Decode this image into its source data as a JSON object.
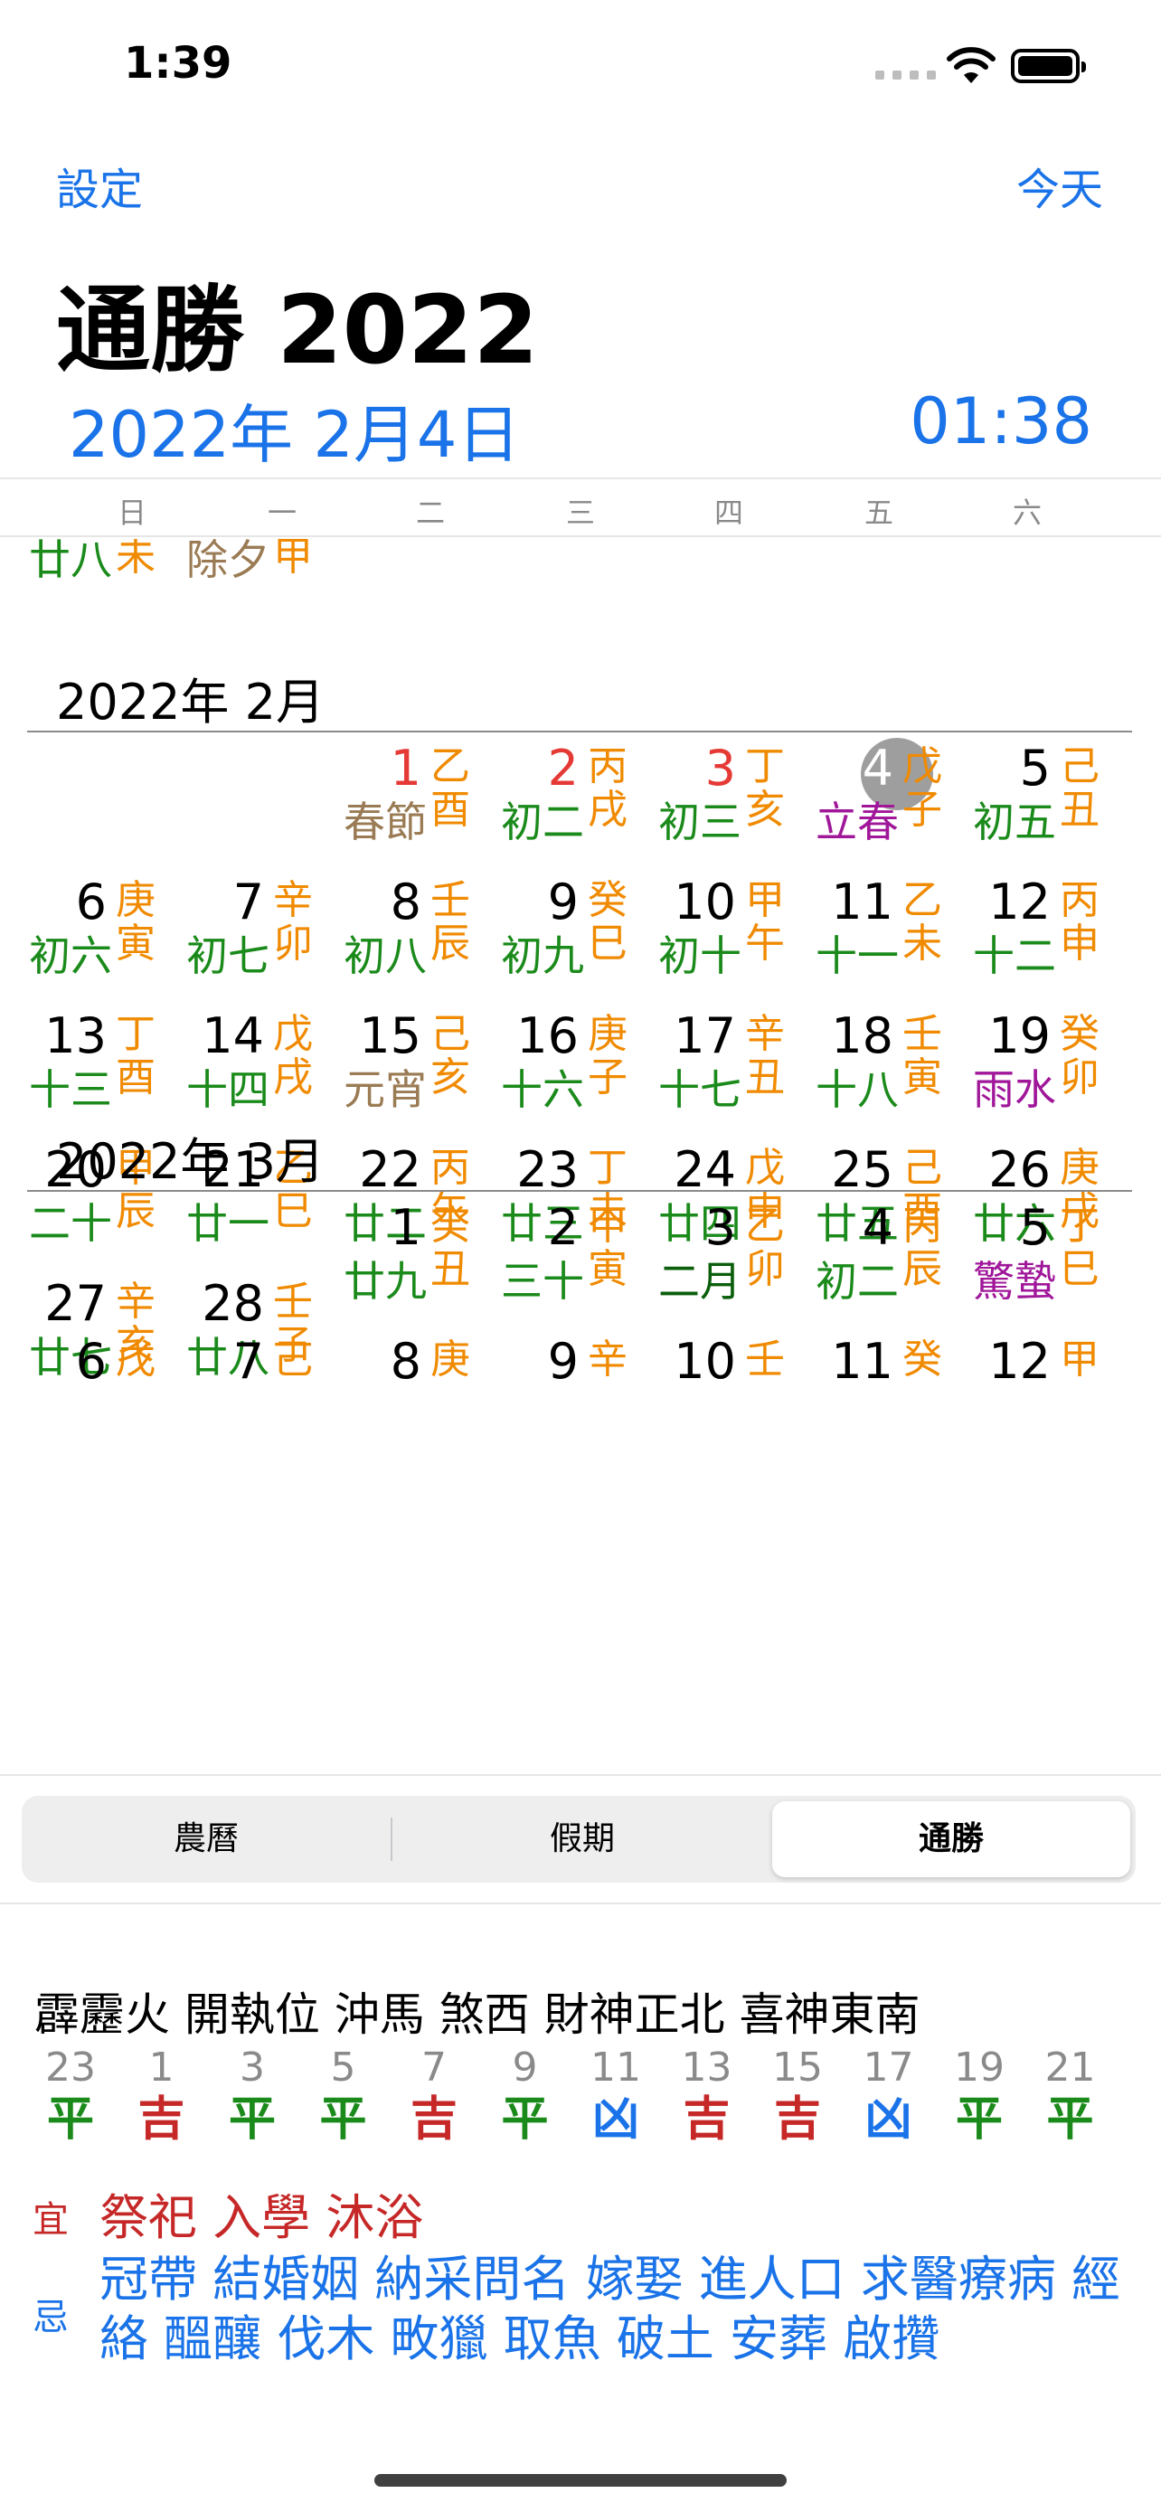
{
  "status": {
    "time": "1:39"
  },
  "nav": {
    "left": "設定",
    "right": "今天"
  },
  "title": "通勝 2022",
  "date": {
    "left": "2022年 2月4日",
    "right": "01:38"
  },
  "weekdays": [
    "日",
    "一",
    "二",
    "三",
    "四",
    "五",
    "六"
  ],
  "partial_top": [
    {
      "text": "廿八",
      "gz": "未",
      "color": "#1a8a1a"
    },
    {
      "text": "除夕",
      "gz": "甲",
      "color": "#9a7b54"
    }
  ],
  "months": [
    {
      "header": "2022年 2月",
      "days": [
        {
          "d": "1",
          "l": "春節",
          "gz": "乙酉",
          "dc": "#e53935",
          "lc": "#9a7b54"
        },
        {
          "d": "2",
          "l": "初二",
          "gz": "丙戌",
          "dc": "#e53935",
          "lc": "#1a8a1a"
        },
        {
          "d": "3",
          "l": "初三",
          "gz": "丁亥",
          "dc": "#e53935",
          "lc": "#1a8a1a"
        },
        {
          "d": "4",
          "l": "立春",
          "gz": "戊子",
          "dc": "#ffffff",
          "lc": "#a0179a"
        },
        {
          "d": "5",
          "l": "初五",
          "gz": "己丑",
          "dc": "#000",
          "lc": "#1a8a1a"
        },
        {
          "d": "6",
          "l": "初六",
          "gz": "庚寅",
          "dc": "#000",
          "lc": "#1a8a1a"
        },
        {
          "d": "7",
          "l": "初七",
          "gz": "辛卯",
          "dc": "#000",
          "lc": "#1a8a1a"
        },
        {
          "d": "8",
          "l": "初八",
          "gz": "壬辰",
          "dc": "#000",
          "lc": "#1a8a1a"
        },
        {
          "d": "9",
          "l": "初九",
          "gz": "癸巳",
          "dc": "#000",
          "lc": "#1a8a1a"
        },
        {
          "d": "10",
          "l": "初十",
          "gz": "甲午",
          "dc": "#000",
          "lc": "#1a8a1a"
        },
        {
          "d": "11",
          "l": "十一",
          "gz": "乙未",
          "dc": "#000",
          "lc": "#1a8a1a"
        },
        {
          "d": "12",
          "l": "十二",
          "gz": "丙申",
          "dc": "#000",
          "lc": "#1a8a1a"
        },
        {
          "d": "13",
          "l": "十三",
          "gz": "丁酉",
          "dc": "#000",
          "lc": "#1a8a1a"
        },
        {
          "d": "14",
          "l": "十四",
          "gz": "戊戌",
          "dc": "#000",
          "lc": "#1a8a1a"
        },
        {
          "d": "15",
          "l": "元宵",
          "gz": "己亥",
          "dc": "#000",
          "lc": "#9a7b54"
        },
        {
          "d": "16",
          "l": "十六",
          "gz": "庚子",
          "dc": "#000",
          "lc": "#1a8a1a"
        },
        {
          "d": "17",
          "l": "十七",
          "gz": "辛丑",
          "dc": "#000",
          "lc": "#1a8a1a"
        },
        {
          "d": "18",
          "l": "十八",
          "gz": "壬寅",
          "dc": "#000",
          "lc": "#1a8a1a"
        },
        {
          "d": "19",
          "l": "雨水",
          "gz": "癸卯",
          "dc": "#000",
          "lc": "#a0179a"
        },
        {
          "d": "20",
          "l": "二十",
          "gz": "甲辰",
          "dc": "#000",
          "lc": "#1a8a1a"
        },
        {
          "d": "21",
          "l": "廿一",
          "gz": "乙巳",
          "dc": "#000",
          "lc": "#1a8a1a"
        },
        {
          "d": "22",
          "l": "廿二",
          "gz": "丙午",
          "dc": "#000",
          "lc": "#1a8a1a"
        },
        {
          "d": "23",
          "l": "廿三",
          "gz": "丁未",
          "dc": "#000",
          "lc": "#1a8a1a"
        },
        {
          "d": "24",
          "l": "廿四",
          "gz": "戊申",
          "dc": "#000",
          "lc": "#1a8a1a"
        },
        {
          "d": "25",
          "l": "廿五",
          "gz": "己酉",
          "dc": "#000",
          "lc": "#1a8a1a"
        },
        {
          "d": "26",
          "l": "廿六",
          "gz": "庚戌",
          "dc": "#000",
          "lc": "#1a8a1a"
        },
        {
          "d": "27",
          "l": "廿七",
          "gz": "辛亥",
          "dc": "#000",
          "lc": "#1a8a1a"
        },
        {
          "d": "28",
          "l": "廿八",
          "gz": "壬子",
          "dc": "#000",
          "lc": "#1a8a1a"
        }
      ]
    },
    {
      "header": "2022年 3月",
      "days": [
        {
          "d": "1",
          "l": "廿九",
          "gz": "癸丑",
          "dc": "#000",
          "lc": "#1a8a1a"
        },
        {
          "d": "2",
          "l": "三十",
          "gz": "甲寅",
          "dc": "#000",
          "lc": "#1a8a1a"
        },
        {
          "d": "3",
          "l": "二月",
          "gz": "乙卯",
          "dc": "#000",
          "lc": "#0b5e0b"
        },
        {
          "d": "4",
          "l": "初二",
          "gz": "丙辰",
          "dc": "#000",
          "lc": "#1a8a1a"
        },
        {
          "d": "5",
          "l": "驚蟄",
          "gz": "丁巳",
          "dc": "#000",
          "lc": "#a0179a"
        },
        {
          "d": "6",
          "l": "",
          "gz": "戊",
          "dc": "#000",
          "lc": "#1a8a1a"
        },
        {
          "d": "7",
          "l": "",
          "gz": "己",
          "dc": "#000",
          "lc": "#1a8a1a"
        },
        {
          "d": "8",
          "l": "",
          "gz": "庚",
          "dc": "#000",
          "lc": "#1a8a1a"
        },
        {
          "d": "9",
          "l": "",
          "gz": "辛",
          "dc": "#000",
          "lc": "#1a8a1a"
        },
        {
          "d": "10",
          "l": "",
          "gz": "壬",
          "dc": "#000",
          "lc": "#1a8a1a"
        },
        {
          "d": "11",
          "l": "",
          "gz": "癸",
          "dc": "#000",
          "lc": "#1a8a1a"
        },
        {
          "d": "12",
          "l": "",
          "gz": "甲",
          "dc": "#000",
          "lc": "#1a8a1a"
        }
      ]
    }
  ],
  "segments": [
    "農曆",
    "假期",
    "通勝"
  ],
  "selected_segment": "通勝",
  "info_line": "霹靂火 開執位 沖馬 煞西 財神正北 喜神東南",
  "hours": [
    {
      "h": "23",
      "v": "平",
      "c": "#1a8a1a"
    },
    {
      "h": "1",
      "v": "吉",
      "c": "#c62828"
    },
    {
      "h": "3",
      "v": "平",
      "c": "#1a8a1a"
    },
    {
      "h": "5",
      "v": "平",
      "c": "#1a8a1a"
    },
    {
      "h": "7",
      "v": "吉",
      "c": "#c62828"
    },
    {
      "h": "9",
      "v": "平",
      "c": "#1a8a1a"
    },
    {
      "h": "11",
      "v": "凶",
      "c": "#1a73e8"
    },
    {
      "h": "13",
      "v": "吉",
      "c": "#c62828"
    },
    {
      "h": "15",
      "v": "吉",
      "c": "#c62828"
    },
    {
      "h": "17",
      "v": "凶",
      "c": "#1a73e8"
    },
    {
      "h": "19",
      "v": "平",
      "c": "#1a8a1a"
    },
    {
      "h": "21",
      "v": "平",
      "c": "#1a8a1a"
    }
  ],
  "yi": {
    "label": "宜",
    "text": "祭祀 入學 沐浴"
  },
  "ji": {
    "label": "忌",
    "text": "冠帶 結婚姻 納采問名 嫁娶 進人口 求醫療病 經絡 醞釀 伐木 畋獵 取魚 破土 安葬 啟攢"
  }
}
